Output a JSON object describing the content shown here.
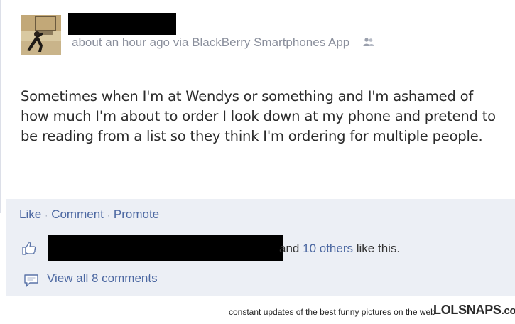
{
  "post": {
    "meta": "about an hour ago via BlackBerry Smartphones App",
    "audience_icon": "friends-icon",
    "body": "Sometimes when I'm at Wendys or something and I'm ashamed of how much I'm about to order I look down at my phone and pretend to be reading from a list so they think I'm ordering for multiple people."
  },
  "actions": {
    "like": "Like",
    "comment": "Comment",
    "promote": "Promote"
  },
  "likes": {
    "suffix_and": "and",
    "others_link": "10 others",
    "suffix_this": "like this."
  },
  "comments": {
    "view_all": "View all 8 comments"
  },
  "footer": {
    "tagline": "constant updates of the best funny pictures on the web",
    "brand": "LOLSNAPS",
    "brand_tld": ".com"
  },
  "colors": {
    "link": "#4b67a1",
    "action_bg": "#eceff5",
    "meta_gray": "#8a8f9c"
  }
}
